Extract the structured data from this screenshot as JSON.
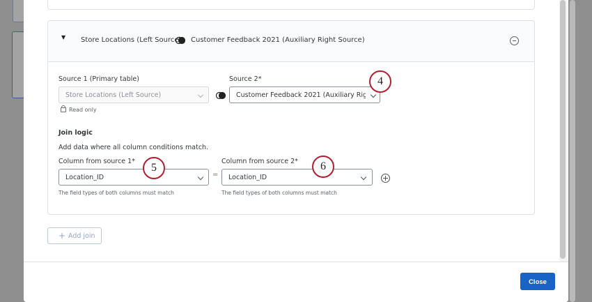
{
  "join": {
    "left_source": "Store Locations (Left Source)",
    "right_source": "Customer Feedback 2021 (Auxiliary Right Source)"
  },
  "source1": {
    "label": "Source 1 (Primary table)",
    "value": "Store Locations (Left Source)",
    "read_only": "Read only"
  },
  "source2": {
    "label": "Source 2*",
    "value": "Customer Feedback 2021 (Auxiliary Right"
  },
  "join_logic": {
    "heading": "Join logic",
    "description": "Add data where all column conditions match.",
    "col1_label": "Column from source 1*",
    "col1_value": "Location_ID",
    "col2_label": "Column from source 2*",
    "col2_value": "Location_ID",
    "equals": "=",
    "hint": "The field types of both columns must match"
  },
  "callouts": {
    "c4": "4",
    "c5": "5",
    "c6": "6"
  },
  "add_join_label": "Add join",
  "add_join_plus": "+",
  "close_label": "Close",
  "colors": {
    "primary": "#1a63c6",
    "callout_border": "#b11f2e"
  },
  "icons": [
    "caret-down-icon",
    "join-icon",
    "minus-circle-icon",
    "chevron-down-icon",
    "lock-icon",
    "plus-circle-icon",
    "plus-icon"
  ]
}
